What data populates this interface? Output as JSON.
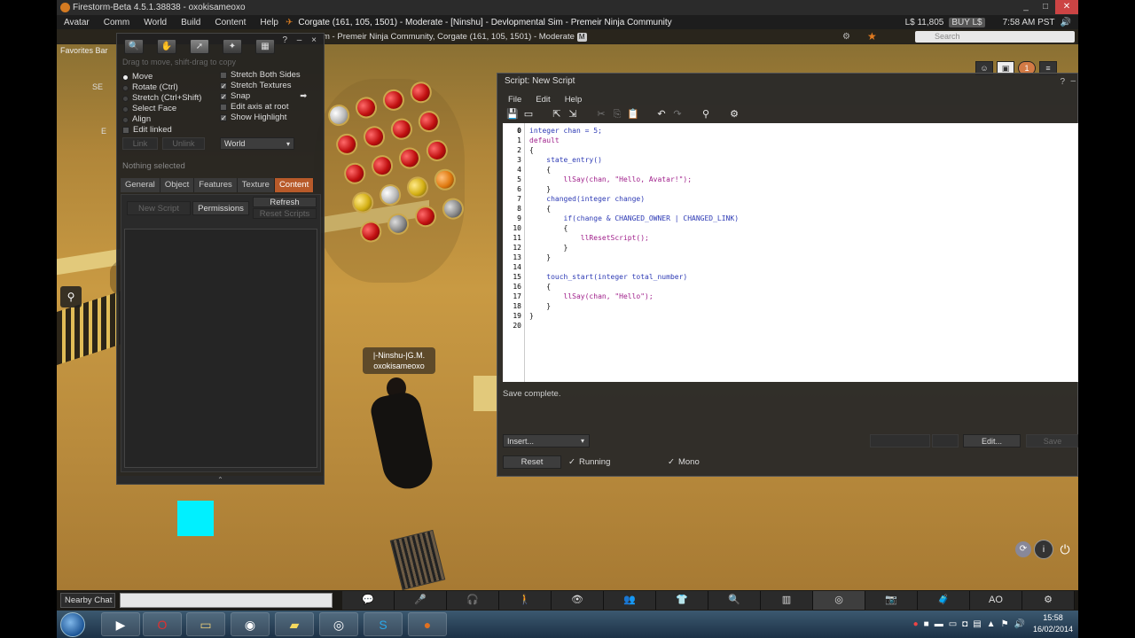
{
  "window": {
    "title": "Firestorm-Beta 4.5.1.38838 - oxokisameoxo",
    "controls": [
      "_",
      "□",
      "✕"
    ]
  },
  "menubar": {
    "items": [
      "Avatar",
      "Comm",
      "World",
      "Build",
      "Content",
      "Help"
    ],
    "region": "Corgate (161, 105, 1501) - Moderate - [Ninshu] - Devlopmental Sim - Premeir Ninja Community",
    "balance": "L$ 11,805",
    "buy_label": "BUY L$",
    "time": "7:58 AM PST"
  },
  "navbar": {
    "favorites": "Favorites Bar",
    "location": "m - Premeir Ninja Community, Corgate (161, 105, 1501) - Moderate",
    "rating_badge": "M",
    "search_placeholder": "Search"
  },
  "minimap": {
    "se": "SE",
    "e": "E"
  },
  "build": {
    "hint": "Drag to move, shift-drag to copy",
    "options_left": [
      {
        "label": "Move",
        "type": "radio",
        "on": true
      },
      {
        "label": "Rotate (Ctrl)",
        "type": "radio",
        "on": false
      },
      {
        "label": "Stretch (Ctrl+Shift)",
        "type": "radio",
        "on": false
      },
      {
        "label": "Select Face",
        "type": "radio",
        "on": false
      },
      {
        "label": "Align",
        "type": "radio",
        "on": false
      },
      {
        "label": "Edit linked",
        "type": "check",
        "on": false
      }
    ],
    "options_right": [
      {
        "label": "Stretch Both Sides",
        "on": false
      },
      {
        "label": "Stretch Textures",
        "on": true
      },
      {
        "label": "Snap",
        "on": true
      },
      {
        "label": "Edit axis at root",
        "on": false
      },
      {
        "label": "Show Highlight",
        "on": true
      }
    ],
    "link_label": "Link",
    "unlink_label": "Unlink",
    "ruler": "World",
    "nothing_selected": "Nothing selected",
    "tabs": [
      "General",
      "Object",
      "Features",
      "Texture",
      "Content"
    ],
    "active_tab": "Content",
    "new_script": "New Script",
    "permissions": "Permissions",
    "refresh": "Refresh",
    "reset_scripts": "Reset Scripts"
  },
  "avatar": {
    "group": "|-Ninshu-|G.M.",
    "name": "oxokisameoxo"
  },
  "script": {
    "title": "Script: New Script",
    "menu": [
      "File",
      "Edit",
      "Help"
    ],
    "lines": [
      "integer chan = 5;",
      "default",
      "{",
      "    state_entry()",
      "    {",
      "        llSay(chan, \"Hello, Avatar!\");",
      "    }",
      "    changed(integer change)",
      "    {",
      "        if(change & CHANGED_OWNER | CHANGED_LINK)",
      "        {",
      "            llResetScript();",
      "        }",
      "    }",
      "",
      "    touch_start(integer total_number)",
      "    {",
      "        llSay(chan, \"Hello\");",
      "    }",
      "}",
      ""
    ],
    "line_numbers": [
      "0",
      "1",
      "2",
      "3",
      "4",
      "5",
      "6",
      "7",
      "8",
      "9",
      "10",
      "11",
      "12",
      "13",
      "14",
      "15",
      "16",
      "17",
      "18",
      "19",
      "20"
    ],
    "status": "Save complete.",
    "insert": "Insert...",
    "edit": "Edit...",
    "save": "Save",
    "reset": "Reset",
    "running": "Running",
    "mono": "Mono"
  },
  "chatbar": {
    "nearby": "Nearby Chat",
    "ao": "AO"
  },
  "taskbar": {
    "clock_time": "15:58",
    "clock_date": "16/02/2014"
  },
  "top_right": {
    "notify_count": "1"
  }
}
